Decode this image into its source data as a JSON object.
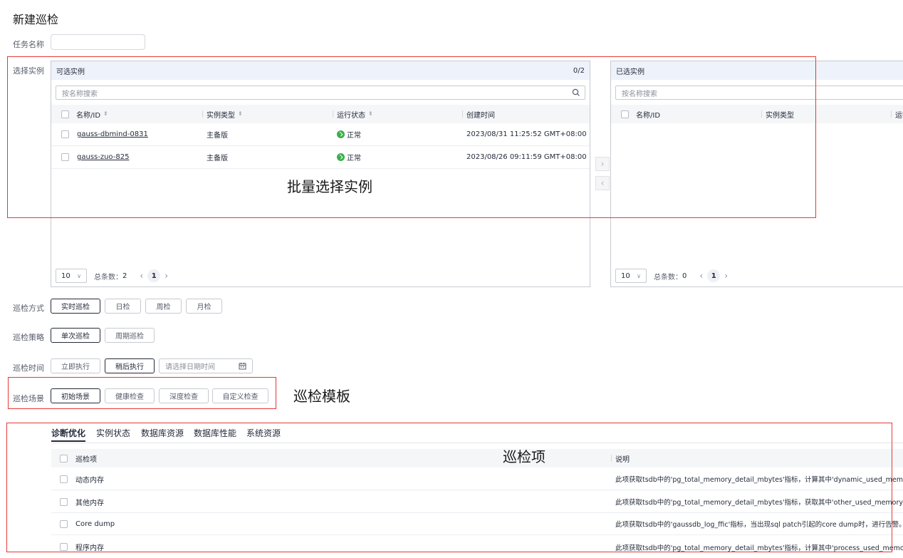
{
  "page": {
    "title": "新建巡检"
  },
  "task_name": {
    "label": "任务名称",
    "value": ""
  },
  "instance_select": {
    "label": "选择实例",
    "available": {
      "title": "可选实例",
      "count": "0/2",
      "search_placeholder": "按名称搜索",
      "columns": [
        "名称/ID",
        "实例类型",
        "运行状态",
        "创建时间"
      ],
      "rows": [
        {
          "name": "gauss-dbmind-0831",
          "type": "主备版",
          "status": "正常",
          "created": "2023/08/31 11:25:52 GMT+08:00"
        },
        {
          "name": "gauss-zuo-825",
          "type": "主备版",
          "status": "正常",
          "created": "2023/08/26 09:11:59 GMT+08:00"
        }
      ],
      "page_size": "10",
      "total_label": "总条数：",
      "total": "2",
      "page": "1"
    },
    "selected": {
      "title": "已选实例",
      "search_placeholder": "按名称搜索",
      "columns": [
        "名称/ID",
        "实例类型",
        "运行"
      ],
      "page_size": "10",
      "total_label": "总条数：",
      "total": "0",
      "page": "1"
    }
  },
  "inspection_mode": {
    "label": "巡检方式",
    "options": [
      "实时巡检",
      "日检",
      "周检",
      "月检"
    ],
    "selected": "实时巡检"
  },
  "inspection_strategy": {
    "label": "巡检策略",
    "options": [
      "单次巡检",
      "周期巡检"
    ],
    "selected": "单次巡检"
  },
  "inspection_time": {
    "label": "巡检时间",
    "options": [
      "立即执行",
      "稍后执行"
    ],
    "selected": "稍后执行",
    "date_placeholder": "请选择日期时间"
  },
  "inspection_scene": {
    "label": "巡检场景",
    "options": [
      "初始场景",
      "健康检查",
      "深度检查",
      "自定义检查"
    ],
    "selected": "初始场景"
  },
  "item_tabs": [
    "诊断优化",
    "实例状态",
    "数据库资源",
    "数据库性能",
    "系统资源"
  ],
  "items_table": {
    "columns": [
      "巡检项",
      "说明"
    ],
    "rows": [
      {
        "name": "动态内存",
        "desc": "此项获取tsdb中的'pg_total_memory_detail_mbytes'指标，计算其中'dynamic_used_memory'相对于"
      },
      {
        "name": "其他内存",
        "desc": "此项获取tsdb中的'pg_total_memory_detail_mbytes'指标，获取其中'other_used_memory'的值，当"
      },
      {
        "name": "Core dump",
        "desc": "此项获取tsdb中的'gaussdb_log_ffic'指标，当出现sql patch引起的core dump时，进行告警。"
      },
      {
        "name": "程序内存",
        "desc": "此项获取tsdb中的'pg_total_memory_detail_mbytes'指标，计算其中'process_used_memory'相对于"
      }
    ]
  },
  "annotations": {
    "batch_select": "批量选择实例",
    "template": "巡检模板",
    "items": "巡检项"
  },
  "colors": {
    "annotation_border": "#e53935",
    "status_ok": "#3bb04b",
    "panel_header": "#eef2fb"
  }
}
